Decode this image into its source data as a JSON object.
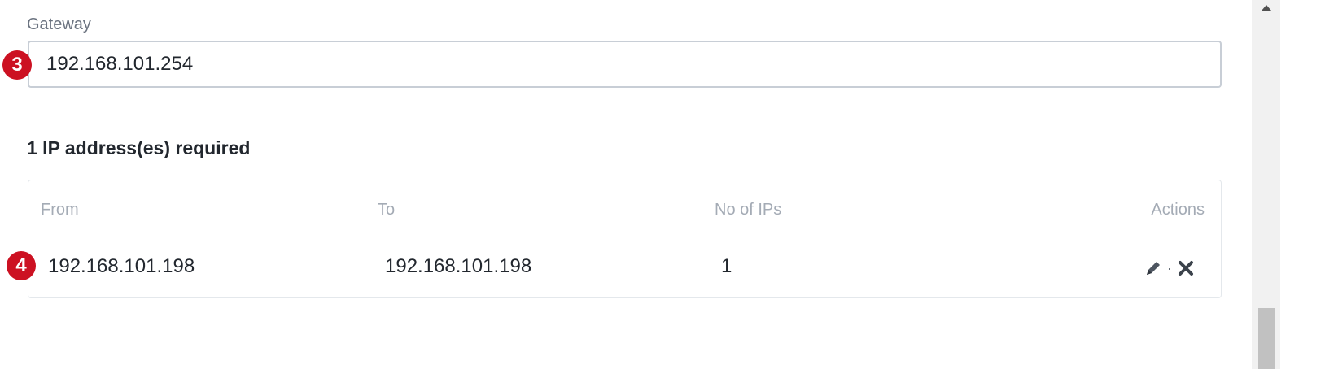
{
  "gateway": {
    "label": "Gateway",
    "value": "192.168.101.254"
  },
  "steps": {
    "gateway_step": "3",
    "range_step": "4"
  },
  "ip_section": {
    "heading": "1 IP address(es) required"
  },
  "ip_table": {
    "columns": [
      "From",
      "To",
      "No of IPs",
      "Actions"
    ],
    "rows": [
      {
        "from": "192.168.101.198",
        "to": "192.168.101.198",
        "count": "1",
        "actions": [
          "edit-icon",
          "delete-icon"
        ],
        "action_separator": "·"
      }
    ]
  },
  "colors": {
    "badge": "#cc1122",
    "text": "#22272e",
    "muted": "#a4abb5",
    "border": "#c8ced6"
  }
}
